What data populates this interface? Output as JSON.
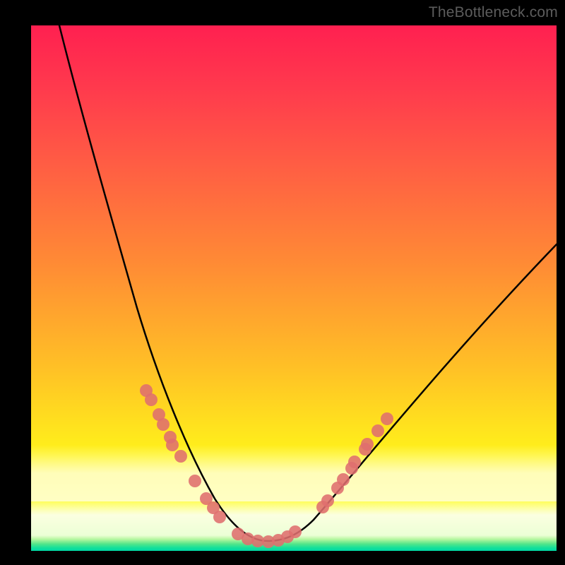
{
  "watermark": "TheBottleneck.com",
  "chart_data": {
    "type": "line",
    "title": "",
    "xlabel": "",
    "ylabel": "",
    "xlim": [
      0,
      100
    ],
    "ylim": [
      0,
      100
    ],
    "grid": false,
    "legend": false,
    "background": "rainbow-gradient red-to-green vertical",
    "series": [
      {
        "name": "bottleneck-curve",
        "color": "#000000",
        "x": [
          0,
          5,
          10,
          15,
          17,
          19,
          21,
          23,
          25,
          27,
          29,
          31,
          33,
          35,
          37,
          38.5,
          40,
          41.5,
          43,
          45,
          47,
          50,
          55,
          60,
          65,
          70,
          75,
          80,
          85,
          90,
          95,
          100
        ],
        "y": [
          100,
          90,
          80,
          67,
          60,
          54,
          48,
          42,
          36,
          31,
          26,
          22,
          18,
          14,
          10,
          7,
          4,
          2.5,
          2,
          2,
          3,
          5,
          10,
          15,
          20,
          25,
          30,
          35,
          40,
          45,
          50,
          54
        ]
      },
      {
        "name": "left-markers",
        "color": "#e27070",
        "type": "scatter",
        "x": [
          19,
          21,
          22.5,
          24,
          25,
          27,
          29.5,
          33,
          35,
          37
        ],
        "y": [
          28,
          27,
          26,
          22,
          21,
          18,
          15,
          8,
          6,
          5
        ]
      },
      {
        "name": "right-markers",
        "color": "#e27070",
        "type": "scatter",
        "x": [
          51,
          52.5,
          54,
          55.5,
          56.5,
          57.5,
          59,
          60.5
        ],
        "y": [
          10,
          13,
          17,
          19,
          22,
          24,
          26,
          28
        ]
      },
      {
        "name": "bottom-markers",
        "color": "#e27070",
        "type": "scatter",
        "x": [
          39,
          40.5,
          42,
          43.5,
          45,
          46.5,
          48
        ],
        "y": [
          2,
          2,
          2,
          2,
          2,
          2.5,
          3
        ]
      }
    ]
  }
}
